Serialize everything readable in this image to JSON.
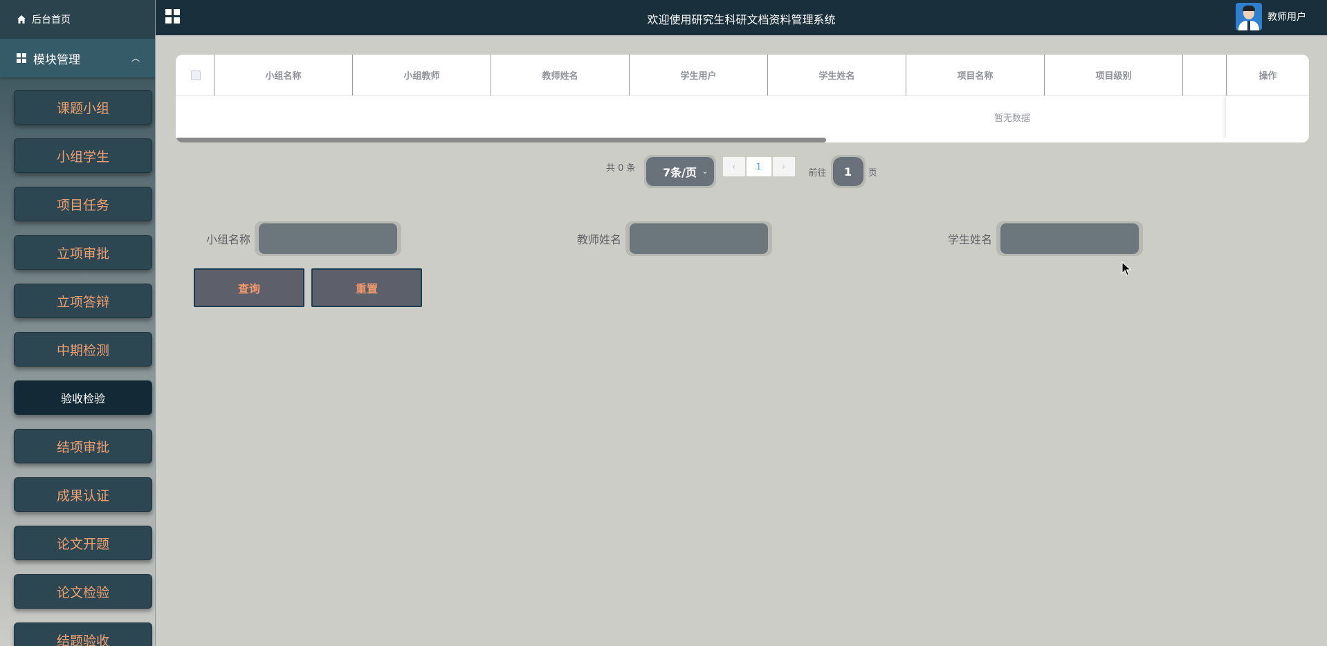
{
  "sidebar": {
    "home_label": "后台首页",
    "module_label": "模块管理",
    "items": [
      {
        "label": "课题小组"
      },
      {
        "label": "小组学生"
      },
      {
        "label": "项目任务"
      },
      {
        "label": "立项审批"
      },
      {
        "label": "立项答辩"
      },
      {
        "label": "中期检测"
      },
      {
        "label": "验收检验"
      },
      {
        "label": "结项审批"
      },
      {
        "label": "成果认证"
      },
      {
        "label": "论文开题"
      },
      {
        "label": "论文检验"
      },
      {
        "label": "结题验收"
      }
    ]
  },
  "header": {
    "title": "欢迎使用研究生科研文档资料管理系统",
    "user_label": "教师用户"
  },
  "table": {
    "columns": [
      "小组名称",
      "小组教师",
      "教师姓名",
      "学生用户",
      "学生姓名",
      "项目名称",
      "项目级别",
      "",
      "操作"
    ],
    "empty_text": "暂无数据"
  },
  "pagination": {
    "total": "共 0 条",
    "page_size": "7条/页",
    "current_page": "1",
    "goto_label": "前往",
    "goto_value": "1",
    "page_unit": "页"
  },
  "search": {
    "group_name_label": "小组名称",
    "teacher_name_label": "教师姓名",
    "student_name_label": "学生姓名",
    "query_button": "查询",
    "reset_button": "重置"
  }
}
